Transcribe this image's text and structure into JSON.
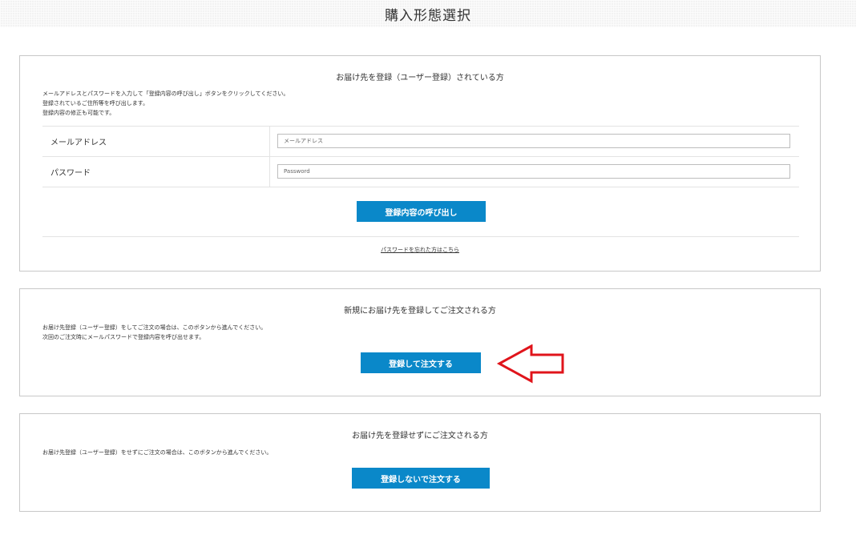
{
  "header": {
    "title": "購入形態選択"
  },
  "registered": {
    "title": "お届け先を登録（ユーザー登録）されている方",
    "desc": [
      "メールアドレスとパスワードを入力して「登録内容の呼び出し」ボタンをクリックしてください。",
      "登録されているご住所等を呼び出します。",
      "登録内容の修正も可能です。"
    ],
    "email_label": "メールアドレス",
    "email_placeholder": "メールアドレス",
    "password_label": "パスワード",
    "password_placeholder": "Password",
    "button_label": "登録内容の呼び出し",
    "forgot_link": "パスワードを忘れた方はこちら"
  },
  "new_register": {
    "title": "新規にお届け先を登録してご注文される方",
    "desc": [
      "お届け先登録（ユーザー登録）をしてご注文の場合は、このボタンから進んでください。",
      "次回のご注文時にメールパスワードで登録内容を呼び出せます。"
    ],
    "button_label": "登録して注文する"
  },
  "guest": {
    "title": "お届け先を登録せずにご注文される方",
    "desc": [
      "お届け先登録（ユーザー登録）をせずにご注文の場合は、このボタンから進んでください。"
    ],
    "button_label": "登録しないで注文する"
  },
  "colors": {
    "button": "#0a88c9",
    "arrow": "#e0141b",
    "border": "#c8c8c8"
  },
  "icons": {
    "annotation": "arrow-left-icon"
  }
}
